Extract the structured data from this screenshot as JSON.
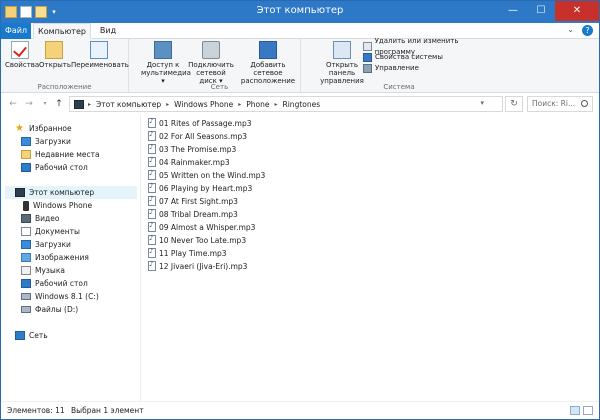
{
  "window": {
    "title": "Этот компьютер"
  },
  "ribbon_tabs": {
    "file": "Файл",
    "computer": "Компьютер",
    "view": "Вид"
  },
  "ribbon": {
    "location": {
      "label": "Расположение",
      "properties": "Свойства",
      "open": "Открыть",
      "rename": "Переименовать"
    },
    "network": {
      "label": "Сеть",
      "media_access_1": "Доступ к",
      "media_access_2": "мультимедиа ▾",
      "map_drive_1": "Подключить",
      "map_drive_2": "сетевой диск ▾",
      "add_location_1": "Добавить сетевое",
      "add_location_2": "расположение"
    },
    "system": {
      "label": "Система",
      "control_panel_1": "Открыть панель",
      "control_panel_2": "управления",
      "uninstall": "Удалить или изменить программу",
      "sys_props": "Свойства системы",
      "manage": "Управление"
    }
  },
  "address": {
    "crumbs": [
      "Этот компьютер",
      "Windows Phone",
      "Phone",
      "Ringtones"
    ],
    "search_placeholder": "Поиск: Ri..."
  },
  "sidebar": {
    "favorites": "Избранное",
    "downloads": "Загрузки",
    "recent": "Недавние места",
    "desktop": "Рабочий стол",
    "this_pc": "Этот компьютер",
    "windows_phone": "Windows Phone",
    "video": "Видео",
    "documents": "Документы",
    "downloads2": "Загрузки",
    "pictures": "Изображения",
    "music": "Музыка",
    "desktop2": "Рабочий стол",
    "drive_c": "Windows 8.1 (C:)",
    "drive_d": "Файлы (D:)",
    "network": "Сеть"
  },
  "files": [
    "01 Rites of Passage.mp3",
    "02 For All Seasons.mp3",
    "03 The Promise.mp3",
    "04 Rainmaker.mp3",
    "05 Written on the Wind.mp3",
    "06 Playing by Heart.mp3",
    "07 At First Sight.mp3",
    "08 Tribal Dream.mp3",
    "09 Almost a Whisper.mp3",
    "10 Never Too Late.mp3",
    "11 Play Time.mp3",
    "12 Jivaeri (Jiva-Eri).mp3"
  ],
  "status": {
    "count": "Элементов: 11",
    "selected": "Выбран 1 элемент"
  }
}
